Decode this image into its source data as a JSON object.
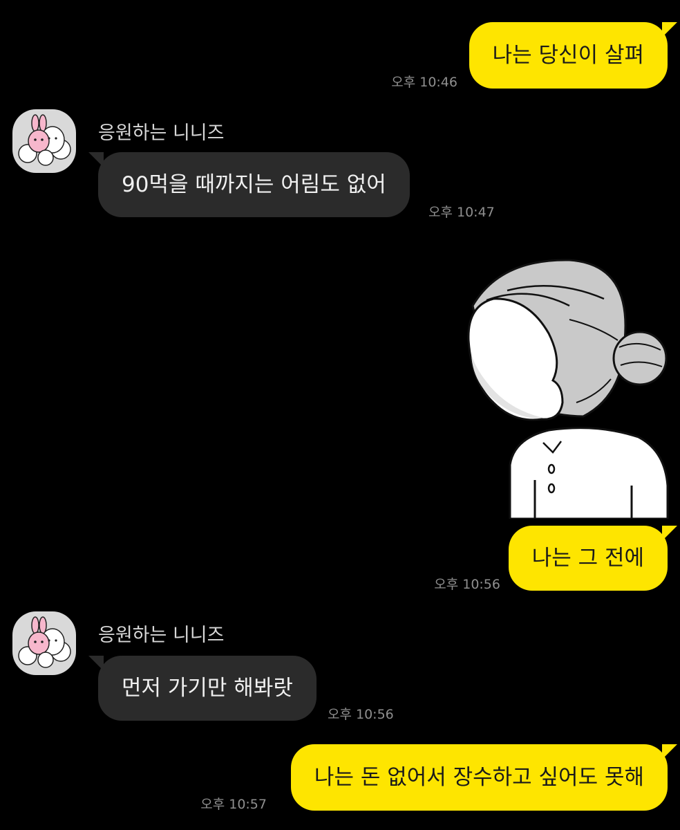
{
  "chat": {
    "messages": [
      {
        "sender": "me",
        "text": "나는 당신이 살펴",
        "time": "오후 10:46"
      },
      {
        "sender": "응원하는 니니즈",
        "text": "90먹을 때까지는 어림도 없어",
        "time": "오후 10:47"
      },
      {
        "sender": "me",
        "type": "sticker",
        "sticker": "gray-haired-character-sticker"
      },
      {
        "sender": "me",
        "text": "나는 그 전에",
        "time": "오후 10:56"
      },
      {
        "sender": "응원하는 니니즈",
        "text": "먼저 가기만 해봐랏",
        "time": "오후 10:56"
      },
      {
        "sender": "me",
        "text": "나는 돈 없어서 장수하고 싶어도 못해",
        "time": "오후 10:57"
      }
    ]
  },
  "colors": {
    "background": "#000000",
    "my_bubble": "#fee500",
    "their_bubble": "#2b2b2b",
    "timestamp": "#8f8f8f"
  }
}
